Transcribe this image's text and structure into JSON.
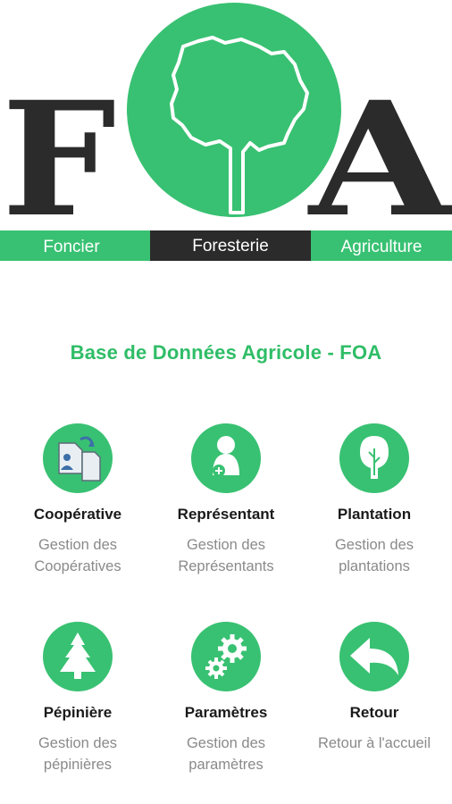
{
  "logo": {
    "letter_left": "F",
    "letter_right": "A",
    "bar": [
      "Foncier",
      "Foresterie",
      "Agriculture"
    ],
    "colors": {
      "green": "#38c172",
      "dark": "#2b2b2b"
    }
  },
  "app_title": "Base de Données Agricole - FOA",
  "menu": [
    {
      "icon": "documents-user-icon",
      "title": "Coopérative",
      "desc1": "Gestion des",
      "desc2": "Coopératives"
    },
    {
      "icon": "person-add-icon",
      "title": "Représentant",
      "desc1": "Gestion des",
      "desc2": "Représentants"
    },
    {
      "icon": "tree-icon",
      "title": "Plantation",
      "desc1": "Gestion des",
      "desc2": "plantations"
    },
    {
      "icon": "pine-tree-icon",
      "title": "Pépinière",
      "desc1": "Gestion des",
      "desc2": "pépinières"
    },
    {
      "icon": "gears-icon",
      "title": "Paramètres",
      "desc1": "Gestion des",
      "desc2": "paramètres"
    },
    {
      "icon": "back-arrow-icon",
      "title": "Retour",
      "desc1": "Retour à l'accueil",
      "desc2": ""
    }
  ]
}
